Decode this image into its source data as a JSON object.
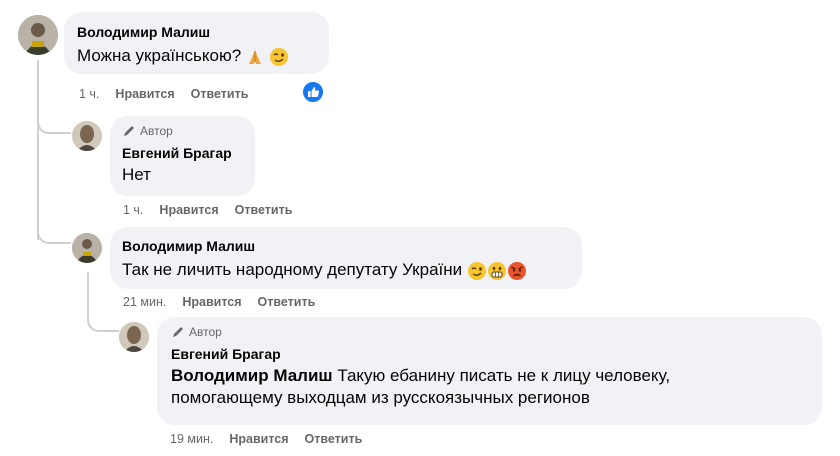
{
  "comments": [
    {
      "author": "Володимир Малиш",
      "text": "Можна українською?",
      "meta": {
        "time": "1 ч.",
        "like": "Нравится",
        "reply": "Ответить"
      }
    },
    {
      "badge": "Автор",
      "author": "Евгений Брагар",
      "text": "Нет",
      "meta": {
        "time": "1 ч.",
        "like": "Нравится",
        "reply": "Ответить"
      }
    },
    {
      "author": "Володимир Малиш",
      "text": "Так не личить народному депутату України",
      "meta": {
        "time": "21 мин.",
        "like": "Нравится",
        "reply": "Ответить"
      }
    },
    {
      "badge": "Автор",
      "author": "Евгений Брагар",
      "mention": "Володимир Малиш",
      "text_line1": "Такую ебанину писать не к лицу человеку,",
      "text_line2": "помогающему выходцам из русскоязычных регионов",
      "meta": {
        "time": "19 мин.",
        "like": "Нравится",
        "reply": "Ответить"
      }
    }
  ],
  "colors": {
    "bubble": "#f0f2f5",
    "meta": "#65676b",
    "like_badge": "#1877f2",
    "thread_line": "#ced0d4"
  },
  "icons": [
    "pencil-icon",
    "like-reaction-icon",
    "folded-hands-emoji",
    "wink-emoji",
    "grimace-emoji",
    "angry-emoji"
  ]
}
